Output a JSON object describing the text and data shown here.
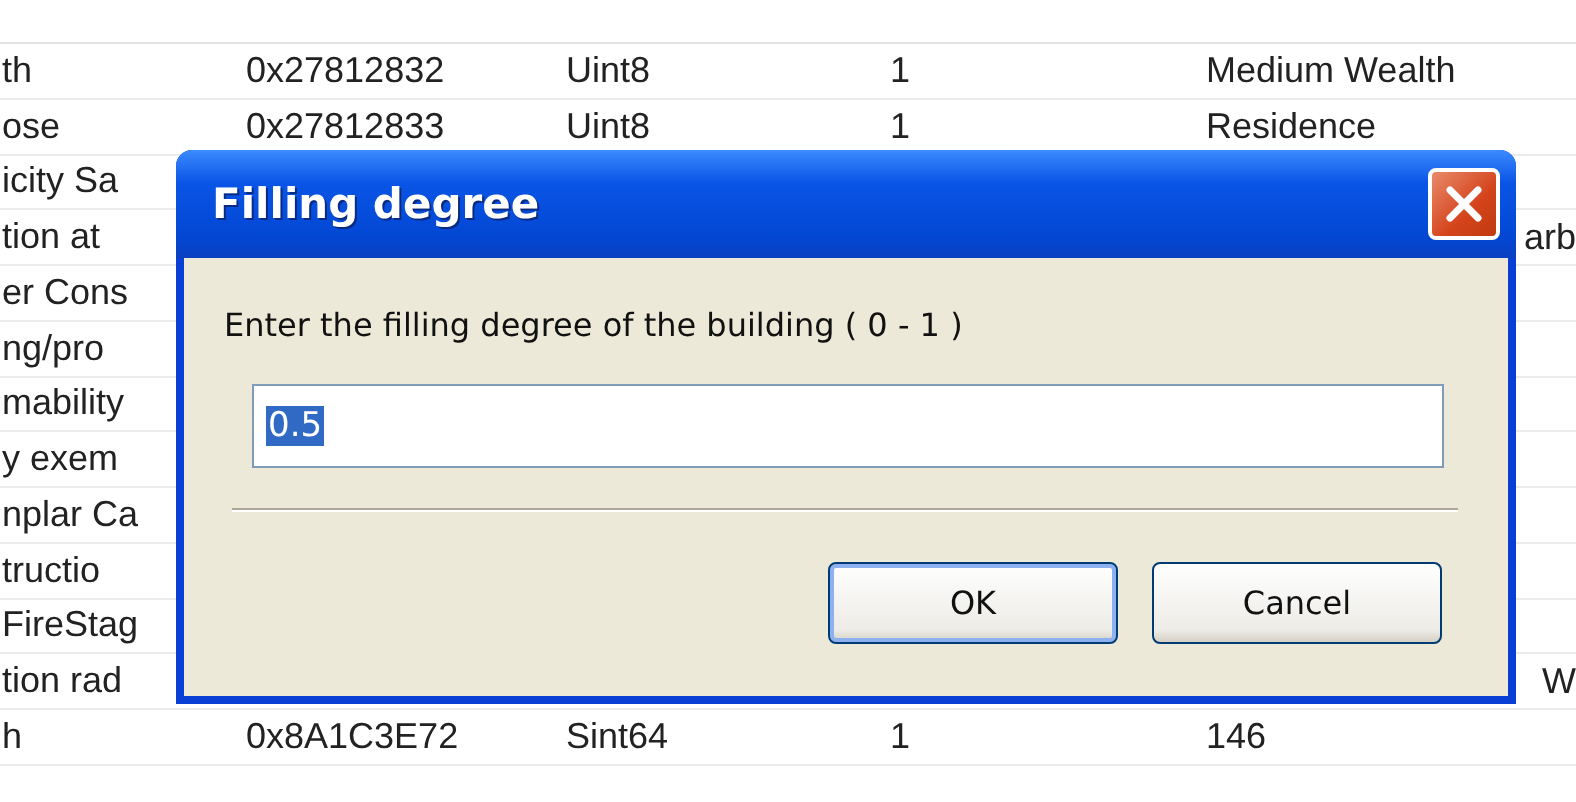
{
  "table": {
    "rows": [
      {
        "column_1": "th",
        "column_2": "0x27812832",
        "column_3": "Uint8",
        "column_4": "1",
        "column_5": "Medium Wealth"
      },
      {
        "column_1": "ose",
        "column_2": "0x27812833",
        "column_3": "Uint8",
        "column_4": "1",
        "column_5": "Residence"
      },
      {
        "column_1": "icity Sa"
      },
      {
        "column_1": "tion at",
        "right_edge_text": "arb"
      },
      {
        "column_1": "er Cons"
      },
      {
        "column_1": "ng/pro"
      },
      {
        "column_1": "mability"
      },
      {
        "column_1": "y exem"
      },
      {
        "column_1": "nplar Ca"
      },
      {
        "column_1": "tructio"
      },
      {
        "column_1": "FireStag"
      },
      {
        "column_1": "tion rad",
        "right_edge_text": "W"
      },
      {
        "column_1": "h",
        "column_2": "0x8A1C3E72",
        "column_3": "Sint64",
        "column_4": "1",
        "column_5": "146"
      }
    ]
  },
  "dialog": {
    "title": "Filling degree",
    "prompt": "Enter the filling degree of the building ( 0 - 1 )",
    "input": {
      "value": "0.5",
      "value_selected": true
    },
    "buttons": [
      {
        "label": "OK",
        "default": true
      },
      {
        "label": "Cancel",
        "default": false
      }
    ]
  }
}
